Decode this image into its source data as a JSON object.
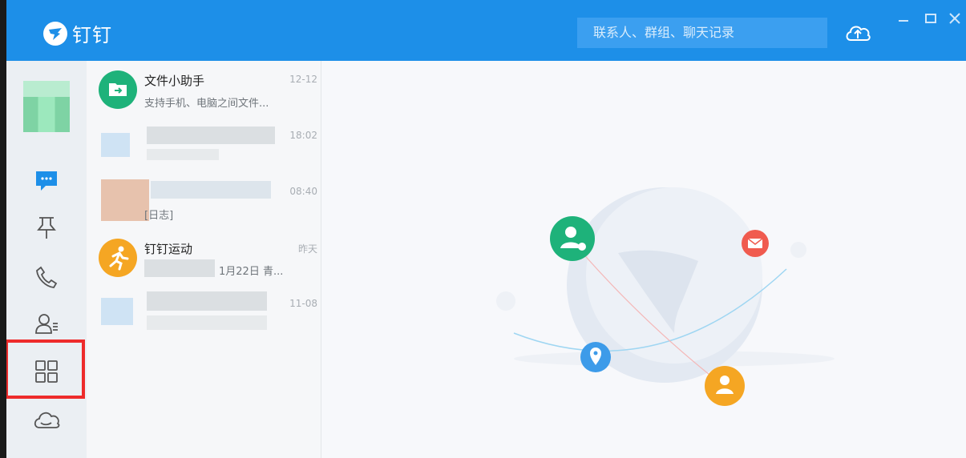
{
  "app": {
    "name": "钉钉",
    "accent": "#1d8fe8"
  },
  "titlebar": {
    "search_placeholder": "联系人、群组、聊天记录",
    "cloud_icon": "cloud-upload-icon",
    "window_controls": [
      "minimize-icon",
      "maximize-icon",
      "close-icon"
    ]
  },
  "sidebar": {
    "items": [
      {
        "name": "messages",
        "icon": "chat-bubble-icon"
      },
      {
        "name": "ding",
        "icon": "pin-icon"
      },
      {
        "name": "calls",
        "icon": "phone-icon"
      },
      {
        "name": "contacts",
        "icon": "contacts-icon"
      },
      {
        "name": "workbench",
        "icon": "apps-grid-icon"
      },
      {
        "name": "cloud-storage",
        "icon": "cloud-icon"
      }
    ],
    "highlight_color": "#ee2b2b"
  },
  "chats": [
    {
      "name": "文件小助手",
      "time": "12-12",
      "preview": "支持手机、电脑之间文件...",
      "avatar_color": "#1eb27a"
    },
    {
      "name": "",
      "time": "18:02",
      "preview": "",
      "avatar_color": "#d6dade"
    },
    {
      "name": "",
      "time": "08:40",
      "preview": "[日志]",
      "avatar_color": "#d6dade"
    },
    {
      "name": "钉钉运动",
      "time": "昨天",
      "preview": "1月22日 青...",
      "avatar_color": "#f5a623"
    },
    {
      "name": "",
      "time": "11-08",
      "preview": "",
      "avatar_color": "#d6dade"
    }
  ]
}
